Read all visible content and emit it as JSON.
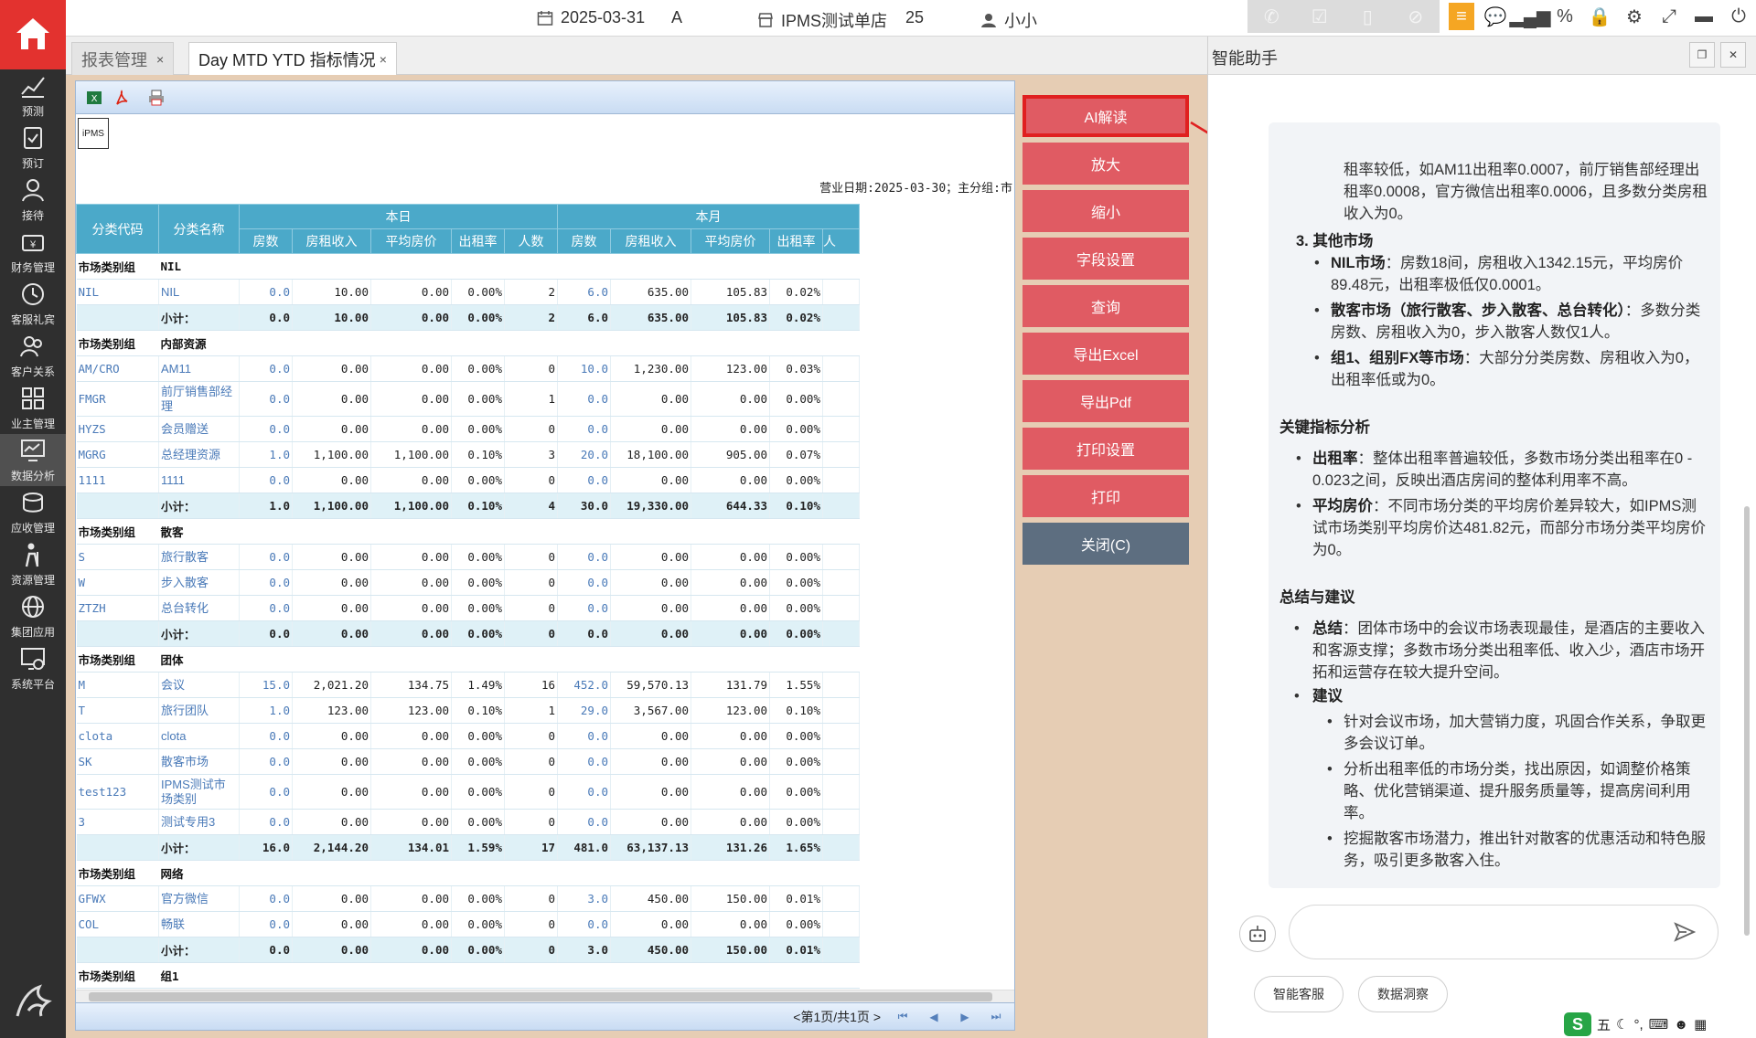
{
  "topbar": {
    "date": "2025-03-31",
    "shift": "A",
    "hotel": "IPMS测试单店",
    "count": "25",
    "user": "小小"
  },
  "sidebar": {
    "items": [
      "预测",
      "预订",
      "接待",
      "财务管理",
      "客服礼宾",
      "客户关系",
      "业主管理",
      "数据分析",
      "应收管理",
      "资源管理",
      "集团应用",
      "系统平台"
    ]
  },
  "tabs": {
    "report_mgmt": "报表管理",
    "current": "Day MTD YTD 指标情况",
    "close": "×"
  },
  "report": {
    "logo": "iPMS",
    "biz_date": "营业日期:2025-03-30；主分组:市",
    "header_top": {
      "code": "分类代码",
      "name": "分类名称",
      "today": "本日",
      "month": "本月"
    },
    "header_sub": {
      "rooms": "房数",
      "revenue": "房租收入",
      "avg": "平均房价",
      "occ": "出租率",
      "persons": "人数",
      "rooms2": "房数",
      "revenue2": "房租收入",
      "avg2": "平均房价",
      "occ2": "出租率",
      "persons2": "人"
    },
    "group_label": "市场类别组",
    "subtotal_label": "小计：",
    "groups": [
      {
        "name": "NIL",
        "rows": [
          [
            "NIL",
            "NIL",
            "0.0",
            "10.00",
            "0.00",
            "0.00%",
            "2",
            "6.0",
            "635.00",
            "105.83",
            "0.02%"
          ]
        ],
        "sub": [
          "0.0",
          "10.00",
          "0.00",
          "0.00%",
          "2",
          "6.0",
          "635.00",
          "105.83",
          "0.02%"
        ]
      },
      {
        "name": "内部资源",
        "rows": [
          [
            "AM/CRO",
            "AM11",
            "0.0",
            "0.00",
            "0.00",
            "0.00%",
            "0",
            "10.0",
            "1,230.00",
            "123.00",
            "0.03%"
          ],
          [
            "FMGR",
            "前厅销售部经理",
            "0.0",
            "0.00",
            "0.00",
            "0.00%",
            "1",
            "0.0",
            "0.00",
            "0.00",
            "0.00%"
          ],
          [
            "HYZS",
            "会员赠送",
            "0.0",
            "0.00",
            "0.00",
            "0.00%",
            "0",
            "0.0",
            "0.00",
            "0.00",
            "0.00%"
          ],
          [
            "MGRG",
            "总经理资源",
            "1.0",
            "1,100.00",
            "1,100.00",
            "0.10%",
            "3",
            "20.0",
            "18,100.00",
            "905.00",
            "0.07%"
          ],
          [
            "1111",
            "1111",
            "0.0",
            "0.00",
            "0.00",
            "0.00%",
            "0",
            "0.0",
            "0.00",
            "0.00",
            "0.00%"
          ]
        ],
        "sub": [
          "1.0",
          "1,100.00",
          "1,100.00",
          "0.10%",
          "4",
          "30.0",
          "19,330.00",
          "644.33",
          "0.10%"
        ]
      },
      {
        "name": "散客",
        "rows": [
          [
            "S",
            "旅行散客",
            "0.0",
            "0.00",
            "0.00",
            "0.00%",
            "0",
            "0.0",
            "0.00",
            "0.00",
            "0.00%"
          ],
          [
            "W",
            "步入散客",
            "0.0",
            "0.00",
            "0.00",
            "0.00%",
            "0",
            "0.0",
            "0.00",
            "0.00",
            "0.00%"
          ],
          [
            "ZTZH",
            "总台转化",
            "0.0",
            "0.00",
            "0.00",
            "0.00%",
            "0",
            "0.0",
            "0.00",
            "0.00",
            "0.00%"
          ]
        ],
        "sub": [
          "0.0",
          "0.00",
          "0.00",
          "0.00%",
          "0",
          "0.0",
          "0.00",
          "0.00",
          "0.00%"
        ]
      },
      {
        "name": "团体",
        "rows": [
          [
            "M",
            "会议",
            "15.0",
            "2,021.20",
            "134.75",
            "1.49%",
            "16",
            "452.0",
            "59,570.13",
            "131.79",
            "1.55%"
          ],
          [
            "T",
            "旅行团队",
            "1.0",
            "123.00",
            "123.00",
            "0.10%",
            "1",
            "29.0",
            "3,567.00",
            "123.00",
            "0.10%"
          ],
          [
            "clota",
            "clota",
            "0.0",
            "0.00",
            "0.00",
            "0.00%",
            "0",
            "0.0",
            "0.00",
            "0.00",
            "0.00%"
          ],
          [
            "SK",
            "散客市场",
            "0.0",
            "0.00",
            "0.00",
            "0.00%",
            "0",
            "0.0",
            "0.00",
            "0.00",
            "0.00%"
          ],
          [
            "test123",
            "IPMS测试市场类别",
            "0.0",
            "0.00",
            "0.00",
            "0.00%",
            "0",
            "0.0",
            "0.00",
            "0.00",
            "0.00%"
          ],
          [
            "3",
            "测试专用3",
            "0.0",
            "0.00",
            "0.00",
            "0.00%",
            "0",
            "0.0",
            "0.00",
            "0.00",
            "0.00%"
          ]
        ],
        "sub": [
          "16.0",
          "2,144.20",
          "134.01",
          "1.59%",
          "17",
          "481.0",
          "63,137.13",
          "131.26",
          "1.65%"
        ]
      },
      {
        "name": "网络",
        "rows": [
          [
            "GFWX",
            "官方微信",
            "0.0",
            "0.00",
            "0.00",
            "0.00%",
            "0",
            "3.0",
            "450.00",
            "150.00",
            "0.01%"
          ],
          [
            "COL",
            "畅联",
            "0.0",
            "0.00",
            "0.00",
            "0.00%",
            "0",
            "0.0",
            "0.00",
            "0.00",
            "0.00%"
          ]
        ],
        "sub": [
          "0.0",
          "0.00",
          "0.00",
          "0.00%",
          "0",
          "3.0",
          "450.00",
          "150.00",
          "0.01%"
        ]
      },
      {
        "name": "组1",
        "rows": [],
        "sub": null
      }
    ],
    "pager": "<第1页/共1页 >"
  },
  "actions": {
    "ai": "AI解读",
    "zoom_in": "放大",
    "zoom_out": "缩小",
    "fields": "字段设置",
    "query": "查询",
    "excel": "导出Excel",
    "pdf": "导出Pdf",
    "print_setup": "打印设置",
    "print": "打印",
    "close": "关闭(C)"
  },
  "assistant": {
    "title": "智能助手",
    "intro": "租率较低，如AM11出租率0.0007，前厅销售部经理出租率0.0008，官方微信出租率0.0006，且多数分类房租收入为0。",
    "other_title": "3. 其他市场",
    "other": [
      {
        "h": "NIL市场",
        "t": "：房数18间，房租收入1342.15元，平均房价89.48元，出租率极低仅0.0001。"
      },
      {
        "h": "散客市场（旅行散客、步入散客、总台转化）",
        "t": "：多数分类房数、房租收入为0，步入散客人数仅1人。"
      },
      {
        "h": "组1、组别FX等市场",
        "t": "：大部分分类房数、房租收入为0，出租率低或为0。"
      }
    ],
    "kpi_title": "关键指标分析",
    "kpi": [
      {
        "h": "出租率",
        "t": "：整体出租率普遍较低，多数市场分类出租率在0 - 0.023之间，反映出酒店房间的整体利用率不高。"
      },
      {
        "h": "平均房价",
        "t": "：不同市场分类的平均房价差异较大，如IPMS测试市场类别平均房价达481.82元，而部分市场分类平均房价为0。"
      }
    ],
    "sum_title": "总结与建议",
    "summary": {
      "h": "总结",
      "t": "：团体市场中的会议市场表现最佳，是酒店的主要收入和客源支撑；多数市场分类出租率低、收入少，酒店市场开拓和运营存在较大提升空间。"
    },
    "advice_title": "建议",
    "advice": [
      "针对会议市场，加大营销力度，巩固合作关系，争取更多会议订单。",
      "分析出租率低的市场分类，找出原因，如调整价格策略、优化营销渠道、提升服务质量等，提高房间利用率。",
      "挖掘散客市场潜力，推出针对散客的优惠活动和特色服务，吸引更多散客入住。"
    ],
    "chip1": "智能客服",
    "chip2": "数据洞察"
  },
  "ime": {
    "label": "五"
  },
  "colors": {
    "sidebar": "#2f2f2f",
    "logo_red": "#e3322f",
    "button_red": "#e05b63",
    "header_teal": "#4ba9c9",
    "frame_tan": "#e6cdb4"
  }
}
